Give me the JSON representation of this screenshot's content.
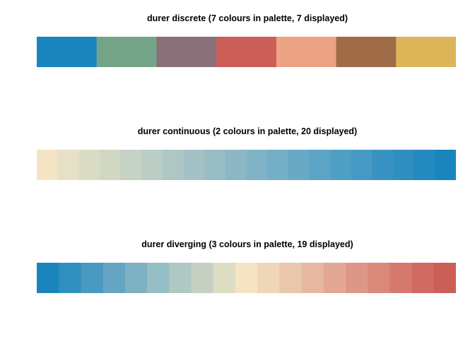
{
  "chart_data": [
    {
      "type": "heatmap",
      "title": "durer discrete (7 colours in palette, 7 displayed)",
      "colors": [
        "#1a85bd",
        "#74a487",
        "#887079",
        "#cc5e58",
        "#eba384",
        "#a06c48",
        "#dcb558"
      ]
    },
    {
      "type": "heatmap",
      "title": "durer continuous (2 colours in palette, 20 displayed)",
      "colors": [
        "#f5e4c3",
        "#e6e1c6",
        "#dbdcc4",
        "#d0d7c2",
        "#c6d2c3",
        "#bbcdc5",
        "#afc7c4",
        "#a4c2c6",
        "#98bdc5",
        "#8cb8c5",
        "#80b3c5",
        "#75aec7",
        "#68a9c6",
        "#5ca4c5",
        "#509fc4",
        "#4599c4",
        "#3993c2",
        "#2e8ec0",
        "#2389be",
        "#1a85bd"
      ]
    },
    {
      "type": "heatmap",
      "title": "durer diverging (3 colours in palette, 19 displayed)",
      "colors": [
        "#1a85bd",
        "#318fc0",
        "#4a99c0",
        "#64a5c4",
        "#7db1c2",
        "#96bec5",
        "#aec8c3",
        "#c6d0c2",
        "#ddddc4",
        "#f5e4c3",
        "#efd6b9",
        "#eac7ac",
        "#e6b8a0",
        "#e3a893",
        "#de9786",
        "#da8879",
        "#d5796e",
        "#d16a63",
        "#cc5e58"
      ]
    }
  ]
}
